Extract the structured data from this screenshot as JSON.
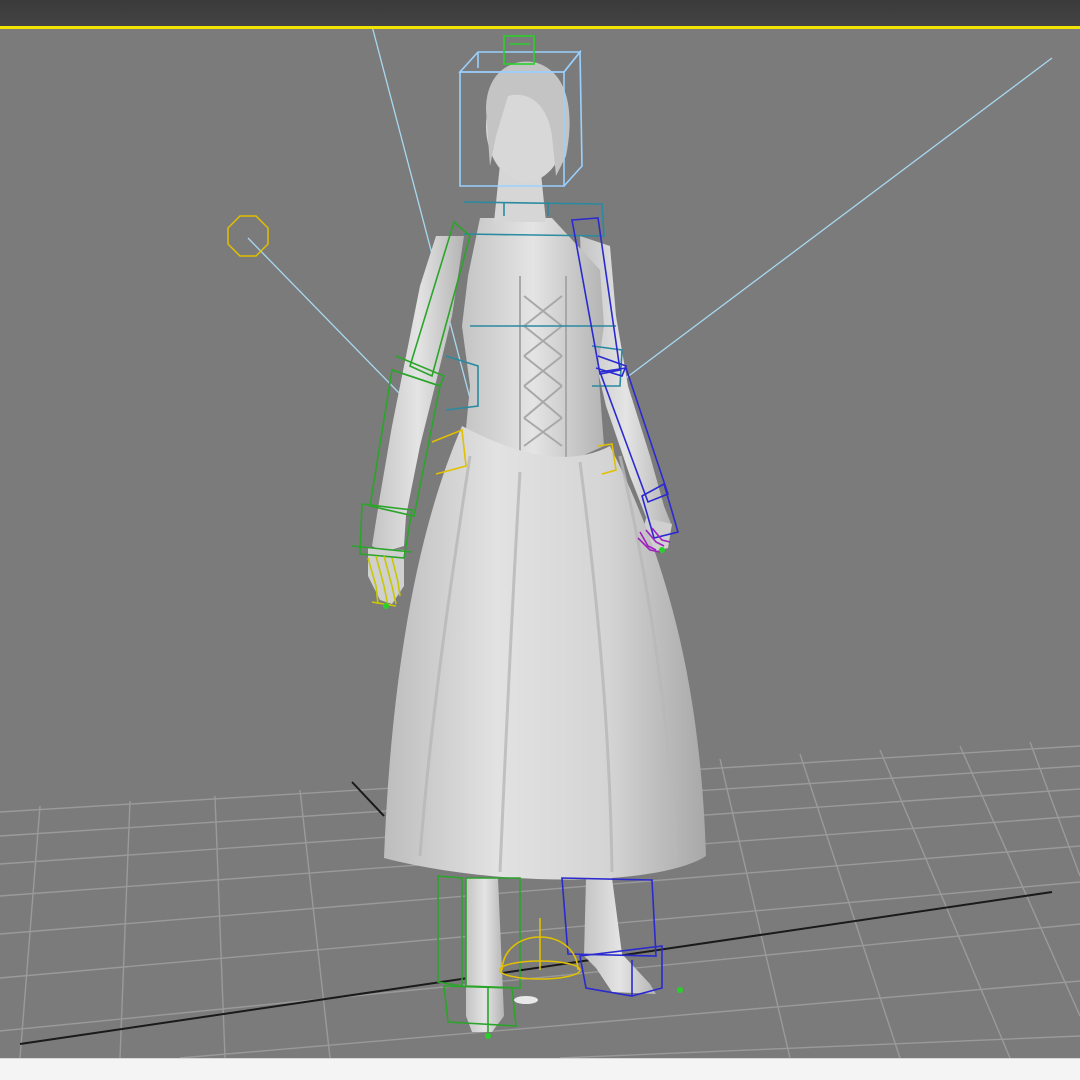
{
  "app": {
    "window": "3d-modeling-viewport"
  },
  "viewport": {
    "view": "perspective",
    "shading": "smooth",
    "active_border_color": "#f1e400",
    "background_color": "#7b7b7b",
    "grid_color": "#9a9a9a",
    "home_grid_axis_color": "#1a1a1a"
  },
  "scene": {
    "model": {
      "subject": "female-character-in-long-dress",
      "material_color": "#d9d9d9"
    },
    "rig": {
      "left_arm_color": "#2aa52a",
      "right_arm_color": "#2a2ad0",
      "spine_color": "#2a8aa0",
      "head_box_color": "#9ad0ff",
      "pelvis_color": "#e0c000",
      "left_hand_color": "#c8c800",
      "right_hand_color": "#a020c0"
    },
    "lights": {
      "target_line_color": "#a8d8f0",
      "light_icon_color": "#e0c000"
    }
  }
}
